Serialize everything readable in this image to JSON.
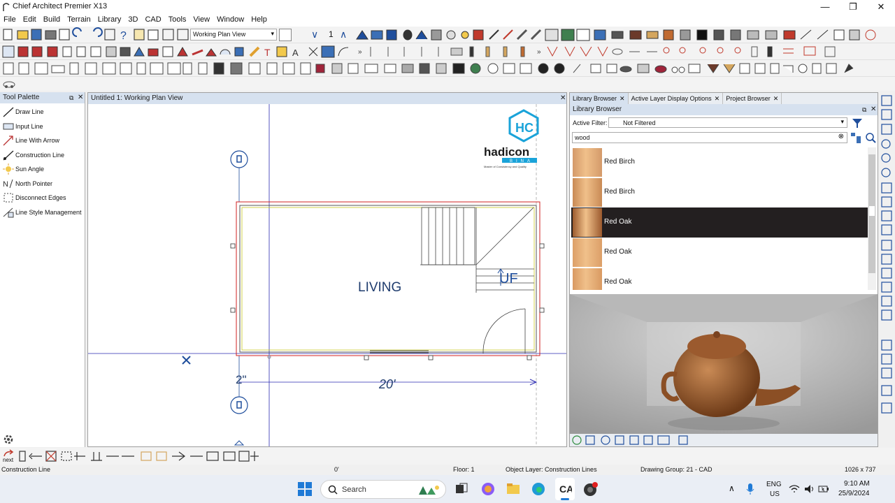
{
  "window": {
    "title": "Chief Architect Premier X13",
    "minimize": "—",
    "maximize": "❐",
    "close": "✕"
  },
  "menu": [
    "File",
    "Edit",
    "Build",
    "Terrain",
    "Library",
    "3D",
    "CAD",
    "Tools",
    "View",
    "Window",
    "Help"
  ],
  "toolbar": {
    "view_select": "Working Plan View",
    "view_number": "1"
  },
  "tool_palette": {
    "title": "Tool Palette",
    "items": [
      "Draw Line",
      "Input Line",
      "Line With Arrow",
      "Construction Line",
      "Sun Angle",
      "North Pointer",
      "Disconnect Edges",
      "Line Style Management"
    ]
  },
  "plan": {
    "tab_title": "Untitled 1:  Working Plan View",
    "room_label": "LIVING",
    "stair_label": "UF",
    "dimension_width": "20'",
    "dimension_small": "2\"",
    "logo_main": "hadicon",
    "logo_sub": "BINA",
    "logo_tag": "Master of Consistency and Quality"
  },
  "library": {
    "tabs": [
      "Library Browser",
      "Active Layer Display Options",
      "Project Browser"
    ],
    "header": "Library Browser",
    "filter_label": "Active Filter:",
    "filter_value": "Not Filtered",
    "search_value": "wood",
    "items": [
      {
        "name": "Red Birch",
        "color": "#d49a6a",
        "selected": false
      },
      {
        "name": "Red Birch",
        "color": "#c98a55",
        "selected": false
      },
      {
        "name": "Red Oak",
        "color": "#9b5a2e",
        "selected": true
      },
      {
        "name": "Red Oak",
        "color": "#dc9f68",
        "selected": false
      },
      {
        "name": "Red Oak",
        "color": "#d99a62",
        "selected": false
      }
    ],
    "selected_bg": "#231f20"
  },
  "status": {
    "tool": "Construction Line",
    "angle": "0'",
    "floor": "Floor: 1",
    "layer": "Object Layer: Construction Lines",
    "group": "Drawing Group: 21 - CAD",
    "size": "1026 x 737"
  },
  "bottom_toolbar": {
    "next_label": "next"
  },
  "taskbar": {
    "search_placeholder": "Search",
    "lang_top": "ENG",
    "lang_bottom": "US",
    "time": "9:10 AM",
    "date": "25/9/2024"
  },
  "colors": {
    "accent_blue": "#1f4e9c",
    "plan_line_blue": "#2a2ab0",
    "logo_blue": "#1aa3d9",
    "wall_red": "#d02020"
  }
}
